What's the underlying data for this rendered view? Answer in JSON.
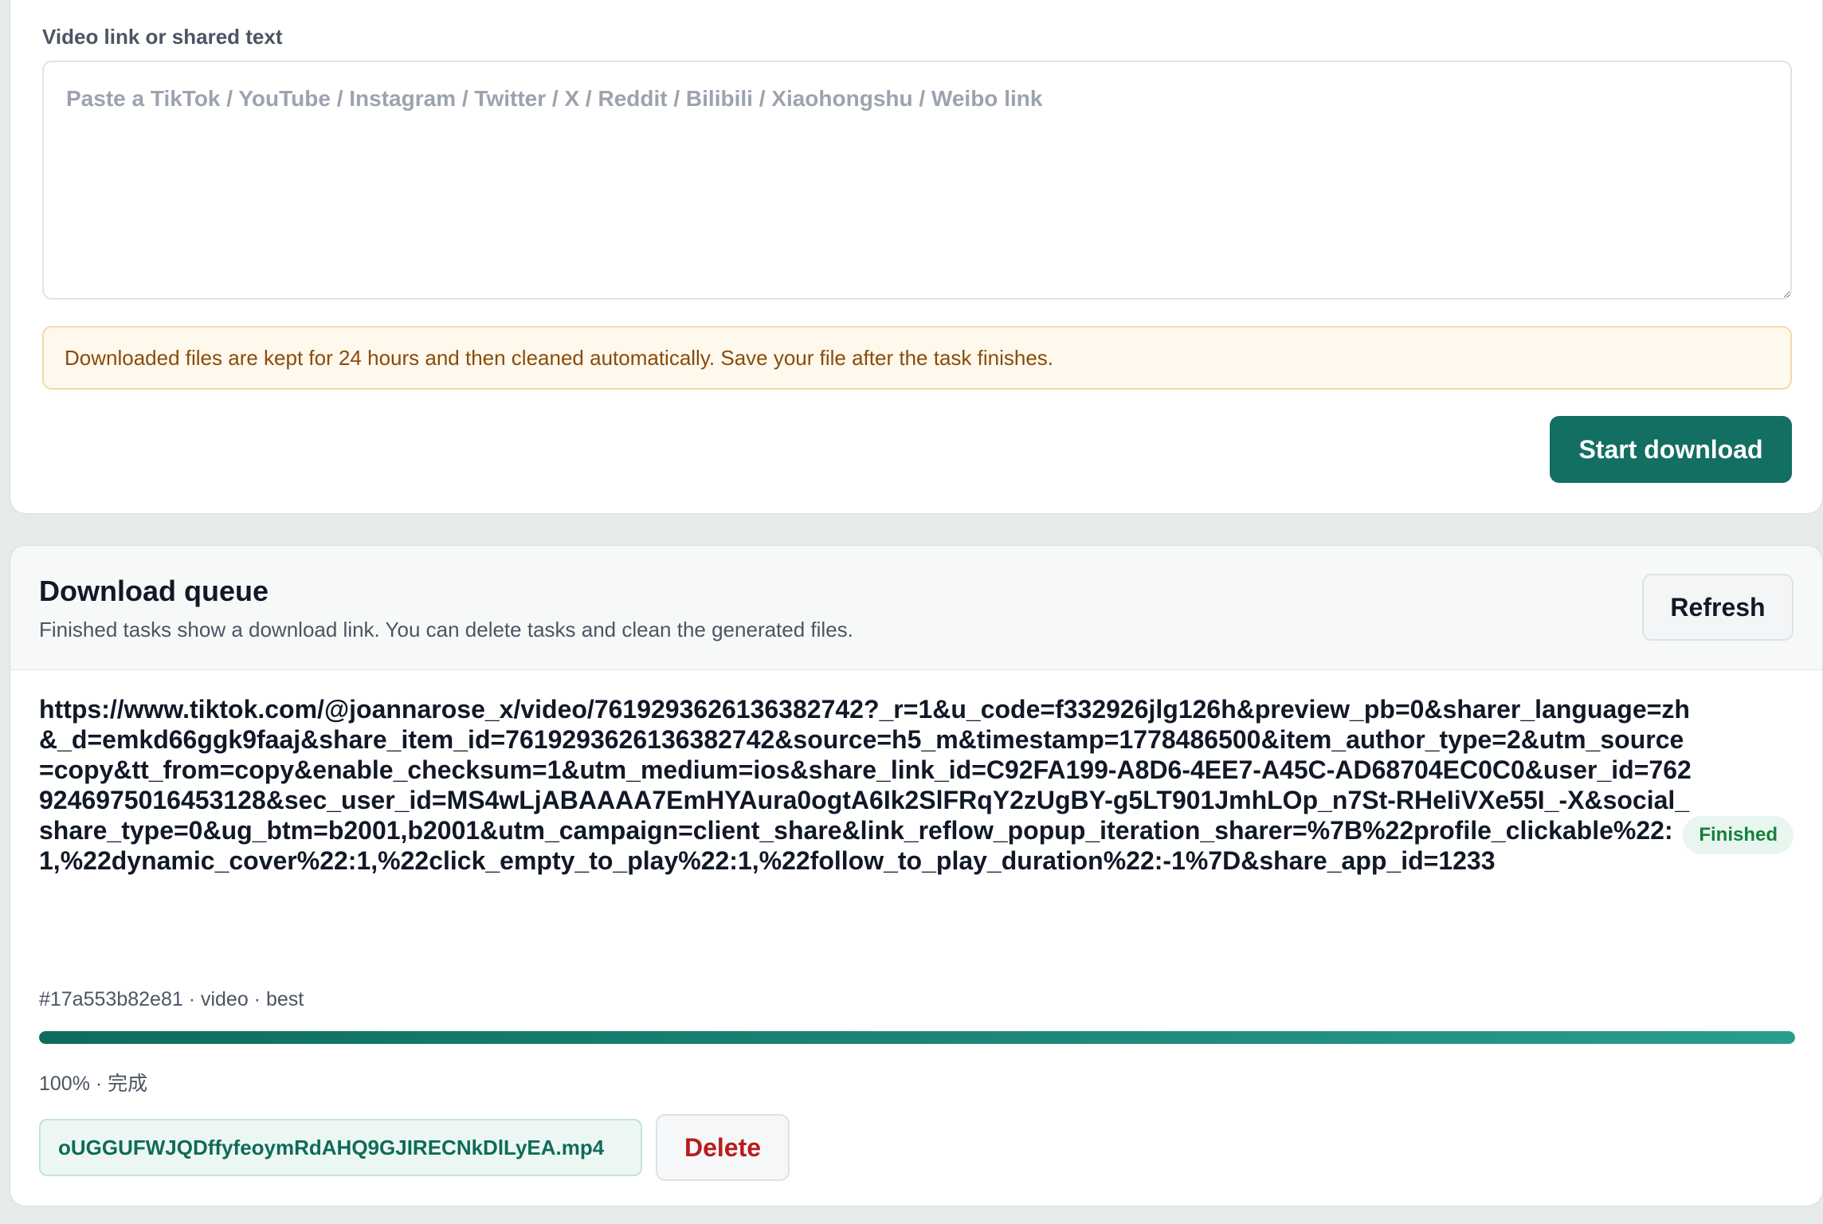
{
  "input_form": {
    "field_label": "Video link or shared text",
    "textarea_value": "",
    "textarea_placeholder": "Paste a TikTok / YouTube / Instagram / Twitter / X / Reddit / Bilibili / Xiaohongshu / Weibo link",
    "notice_text": "Downloaded files are kept for 24 hours and then cleaned automatically. Save your file after the task finishes.",
    "start_button_label": "Start download"
  },
  "queue": {
    "title": "Download queue",
    "subtitle": "Finished tasks show a download link. You can delete tasks and clean the generated files.",
    "refresh_button_label": "Refresh",
    "tasks": [
      {
        "url": "https://www.tiktok.com/@joannarose_x/video/7619293626136382742?_r=1&u_code=f332926jlg126h&preview_pb=0&sharer_language=zh&_d=emkd66ggk9faaj&share_item_id=7619293626136382742&source=h5_m&timestamp=1778486500&item_author_type=2&utm_source=copy&tt_from=copy&enable_checksum=1&utm_medium=ios&share_link_id=C92FA199-A8D6-4EE7-A45C-AD68704EC0C0&user_id=7629246975016453128&sec_user_id=MS4wLjABAAAA7EmHYAura0ogtA6Ik2SlFRqY2zUgBY-g5LT901JmhLOp_n7St-RHeIiVXe55I_-X&social_share_type=0&ug_btm=b2001,b2001&utm_campaign=client_share&link_reflow_popup_iteration_sharer=%7B%22profile_clickable%22:1,%22dynamic_cover%22:1,%22click_empty_to_play%22:1,%22follow_to_play_duration%22:-1%7D&share_app_id=1233",
        "status": "Finished",
        "meta": "#17a553b82e81 · video · best",
        "progress": 1.0,
        "progress_text": "100% · 完成",
        "file_name": "oUGGUFWJQDffyfeoymRdAHQ9GJIRECNkDlLyEA.mp4",
        "delete_label": "Delete"
      }
    ]
  },
  "colors": {
    "accent": "#136f61",
    "status_finished": "#15803d",
    "danger": "#b91c1c",
    "notice_bg": "#fff8ec",
    "notice_text": "#8a4b0a"
  }
}
